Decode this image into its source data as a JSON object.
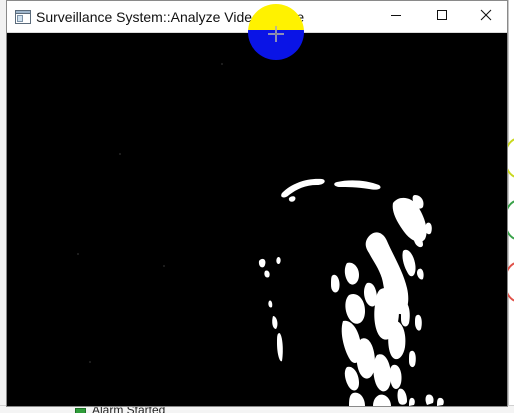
{
  "window": {
    "title": "Surveillance System::Analyze Video Frame",
    "minimize_icon": "minimize-icon",
    "maximize_icon": "maximize-icon",
    "close_icon": "close-icon",
    "app_icon": "window-app-icon"
  },
  "video": {
    "content": "foreground-mask"
  },
  "cursor": {
    "icon": "crosshair-cursor-icon",
    "highlight_top": "#fff200",
    "highlight_bottom": "#0a14e6"
  },
  "background_app": {
    "status_label": "Alarm Started",
    "status_color": "#2f9d3a",
    "rings": [
      "#c9d81e",
      "#3aa24a",
      "#e0524a"
    ]
  },
  "colors": {
    "titlebar": "#ffffff",
    "video_bg": "#000000",
    "mask_fg": "#ffffff"
  }
}
